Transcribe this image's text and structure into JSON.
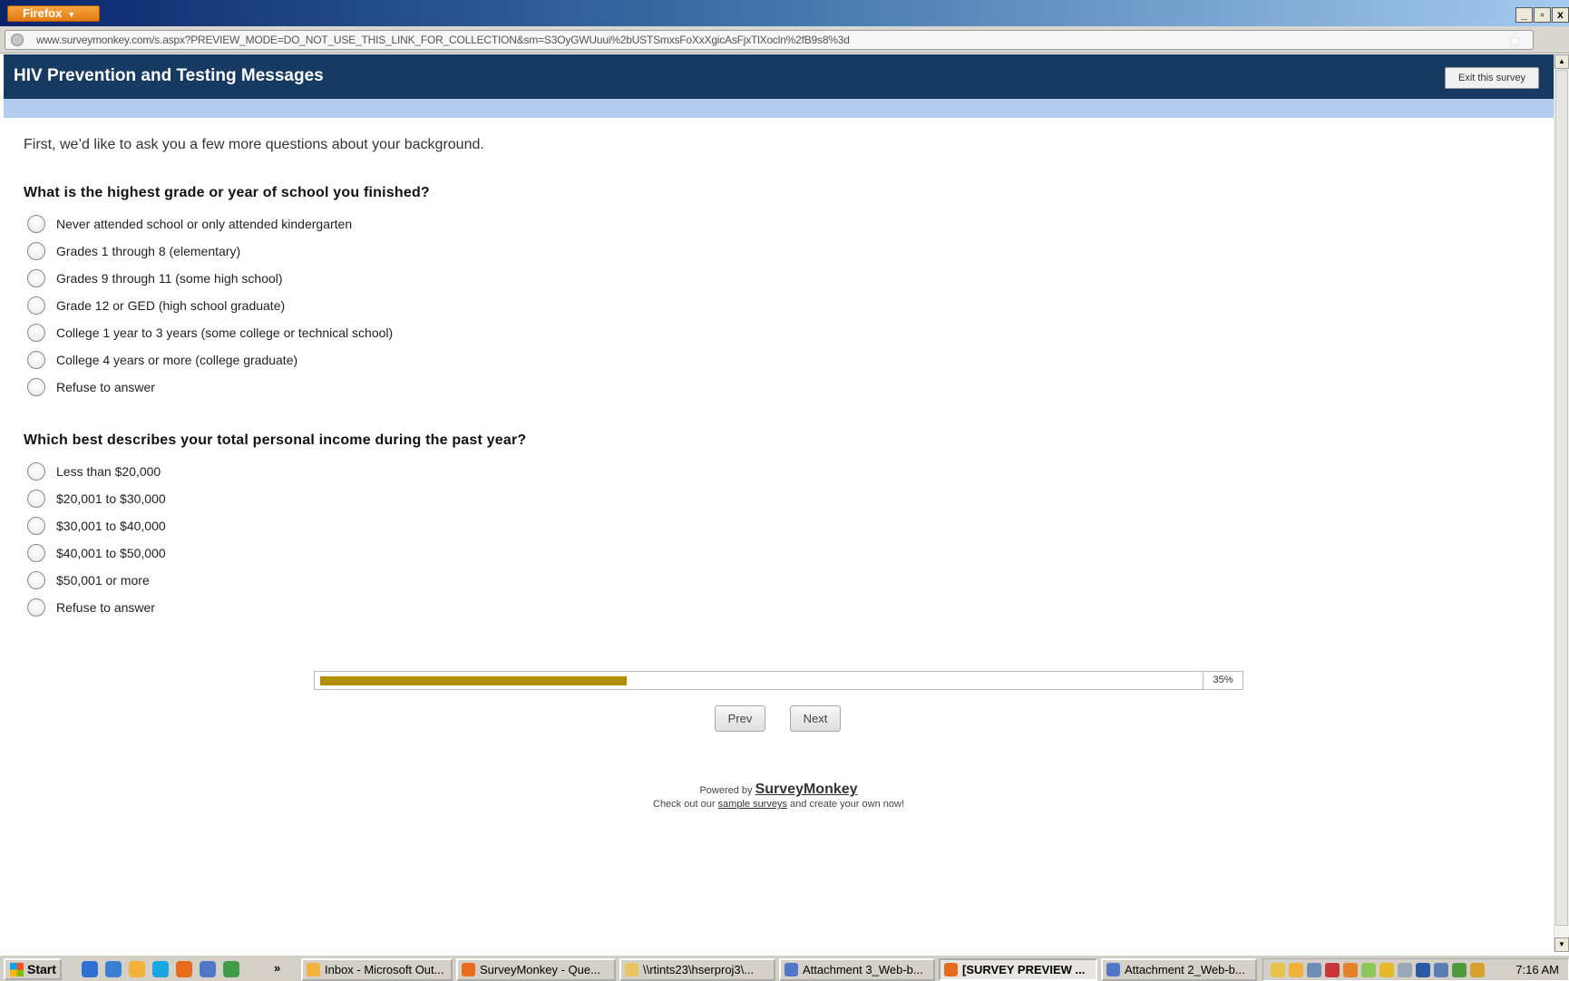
{
  "browser": {
    "menu_button": "Firefox",
    "url": "www.surveymonkey.com/s.aspx?PREVIEW_MODE=DO_NOT_USE_THIS_LINK_FOR_COLLECTION&sm=S3OyGWUuui%2bUSTSmxsFoXxXgicAsFjxTlXocln%2fB9s8%3d",
    "window_controls": [
      "_",
      "▫",
      "x"
    ]
  },
  "survey": {
    "title": "HIV Prevention and Testing Messages",
    "exit_label": "Exit this survey",
    "intro": "First, we’d like to ask you a few more questions about your background.",
    "q1": {
      "text": "What is the highest grade or year of school you finished?",
      "options": [
        "Never attended school or only attended kindergarten",
        "Grades 1 through 8 (elementary)",
        "Grades 9 through 11 (some high school)",
        "Grade 12 or GED (high school graduate)",
        "College 1 year to 3 years (some college or technical school)",
        "College 4 years or more (college graduate)",
        "Refuse to answer"
      ]
    },
    "q2": {
      "text": "Which best describes your total personal income during the past year?",
      "options": [
        "Less than $20,000",
        "$20,001 to $30,000",
        "$30,001 to $40,000",
        "$40,001 to $50,000",
        "$50,001 or more",
        "Refuse to answer"
      ]
    },
    "progress": {
      "percent": 35,
      "label": "35%",
      "color": "#b28e00"
    },
    "prev_label": "Prev",
    "next_label": "Next",
    "footer": {
      "powered_by": "Powered by",
      "brand": "SurveyMonkey",
      "line2_pre": "Check out our",
      "line2_link": "sample surveys",
      "line2_post": "and create your own now!"
    }
  },
  "taskbar": {
    "start_label": "Start",
    "more": "»",
    "tasks": [
      {
        "label": "Inbox - Microsoft Out...",
        "active": false
      },
      {
        "label": "SurveyMonkey - Que...",
        "active": false
      },
      {
        "label": "\\\\rtints23\\hserproj3\\...",
        "active": false
      },
      {
        "label": "Attachment 3_Web-b...",
        "active": false
      },
      {
        "label": "[SURVEY PREVIEW ...",
        "active": true
      },
      {
        "label": "Attachment 2_Web-b...",
        "active": false
      }
    ],
    "clock": "7:16 AM"
  }
}
